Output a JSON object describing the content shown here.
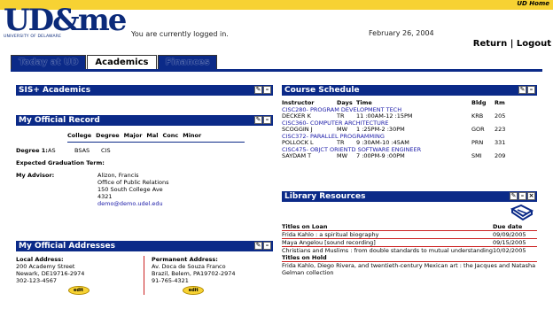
{
  "header": {
    "ud_home": "UD Home",
    "logo_text": "UD&me",
    "logo_sub": "UNIVERSITY OF DELAWARE",
    "logged_in_msg": "You are currently logged in.",
    "date": "February 26, 2004",
    "return_link": "Return",
    "separator": "|",
    "logout_link": "Logout"
  },
  "tabs": [
    "Today at UD",
    "Academics",
    "Finances"
  ],
  "sis": {
    "title": "SIS+ Academics"
  },
  "record": {
    "title": "My Official Record",
    "columns": [
      "College",
      "Degree",
      "Major",
      "Mal",
      "Conc",
      "Minor"
    ],
    "degree_label": "Degree 1:",
    "degree_values": [
      "AS",
      "BSAS",
      "CIS"
    ],
    "expected_label": "Expected Graduation Term:",
    "advisor_label": "My Advisor:",
    "advisor_lines": [
      "Alizon, Francis",
      "Office of Public Relations",
      "150 South College Ave",
      "4321"
    ],
    "advisor_email": "demo@demo.udel.edu"
  },
  "addresses": {
    "title": "My Official Addresses",
    "local": {
      "label": "Local Address:",
      "lines": [
        "200 Academy Street",
        "Newark, DE19716-2974",
        "302-123-4567"
      ]
    },
    "permanent": {
      "label": "Permanent Address:",
      "lines": [
        "Av. Doca de Souza Franco",
        "Brazil, Belem, PA19702-2974",
        "91-765-4321"
      ]
    },
    "edit_label": "edit"
  },
  "schedule": {
    "title": "Course Schedule",
    "headers": [
      "Instructor",
      "Days",
      "Time",
      "Bldg",
      "Rm"
    ],
    "courses": [
      {
        "course": "CISC280- PROGRAM DEVELOPMENT TECH",
        "instructor": "DECKER K",
        "days": "TR",
        "time": "11 :00AM-12 :15PM",
        "bldg": "KRB",
        "rm": "205"
      },
      {
        "course": "CISC360- COMPUTER ARCHITECTURE",
        "instructor": "SCOGGIN J",
        "days": "MW",
        "time": "1 :25PM-2 :30PM",
        "bldg": "GOR",
        "rm": "223"
      },
      {
        "course": "CISC372- PARALLEL PROGRAMMING",
        "instructor": "POLLOCK L",
        "days": "TR",
        "time": "9 :30AM-10 :45AM",
        "bldg": "PRN",
        "rm": "331"
      },
      {
        "course": "CISC475- OBJCT ORIENTD SOFTWARE ENGINEER",
        "instructor": "SAYDAM T",
        "days": "MW",
        "time": "7 :00PM-9 :00PM",
        "bldg": "SMI",
        "rm": "209"
      }
    ]
  },
  "library": {
    "title": "Library Resources",
    "loan_header": "Titles on Loan",
    "due_header": "Due date",
    "loans": [
      {
        "title": "Frida Kahlo : a spiritual biography",
        "due": "09/09/2005"
      },
      {
        "title": "Maya Angelou [sound recording]",
        "due": "09/15/2005"
      },
      {
        "title": "Christians and Muslims : from double standards to mutual understanding",
        "due": "10/02/2005"
      }
    ],
    "hold_header": "Titles on Hold",
    "holds": [
      "Frida Kahlo, Diego Rivera, and twentieth-century Mexican art : the Jacques and Natasha Gelman collection"
    ]
  },
  "colors": {
    "navy": "#0b2a88",
    "gold": "#f7d233",
    "link": "#1a1aa8",
    "red_rule": "#cc2222"
  }
}
